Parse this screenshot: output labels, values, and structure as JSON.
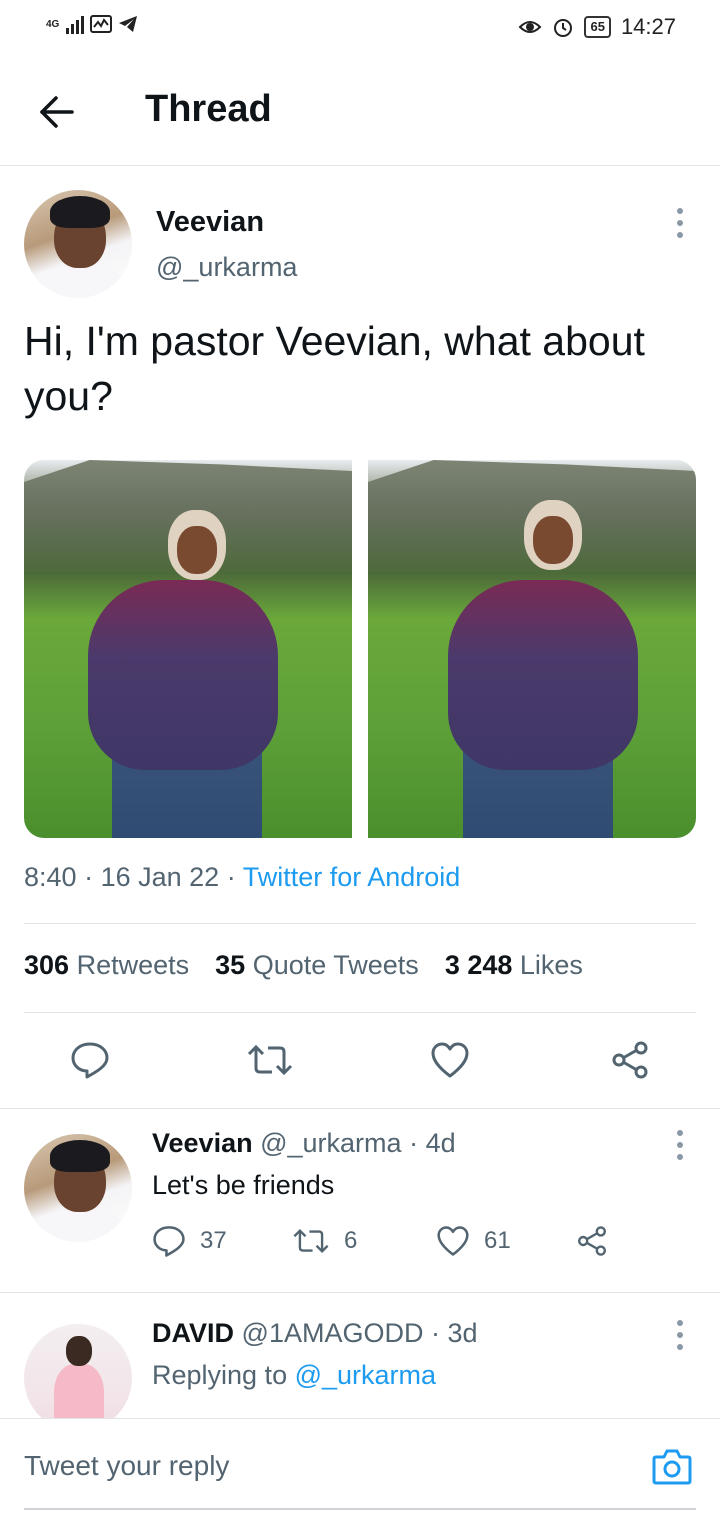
{
  "status_bar": {
    "network": "4G",
    "battery": "65",
    "time": "14:27"
  },
  "header": {
    "title": "Thread"
  },
  "tweet": {
    "author_name": "Veevian",
    "author_handle": "@_urkarma",
    "text": "Hi, I'm pastor Veevian, what about you?",
    "time": "8:40",
    "date": "16 Jan 22",
    "source": "Twitter for Android",
    "stats": {
      "retweets_count": "306",
      "retweets_label": "Retweets",
      "quote_count": "35",
      "quote_label": "Quote Tweets",
      "likes_count": "3 248",
      "likes_label": "Likes"
    }
  },
  "replies": [
    {
      "name": "Veevian",
      "handle": "@_urkarma",
      "age": "4d",
      "text": "Let's be friends",
      "reply_count": "37",
      "retweet_count": "6",
      "like_count": "61"
    },
    {
      "name": "DAVID",
      "handle": "@1AMAGODD",
      "age": "3d",
      "replying_label": "Replying to",
      "replying_to": "@_urkarma"
    }
  ],
  "composer": {
    "placeholder": "Tweet your reply"
  },
  "icons": {
    "back": "arrow-left-icon",
    "more": "more-vertical-icon",
    "reply": "comment-icon",
    "retweet": "retweet-icon",
    "like": "heart-icon",
    "share": "share-icon",
    "camera": "camera-icon"
  },
  "colors": {
    "link": "#1d9bf0",
    "text": "#0f1419",
    "secondary": "#536471"
  }
}
